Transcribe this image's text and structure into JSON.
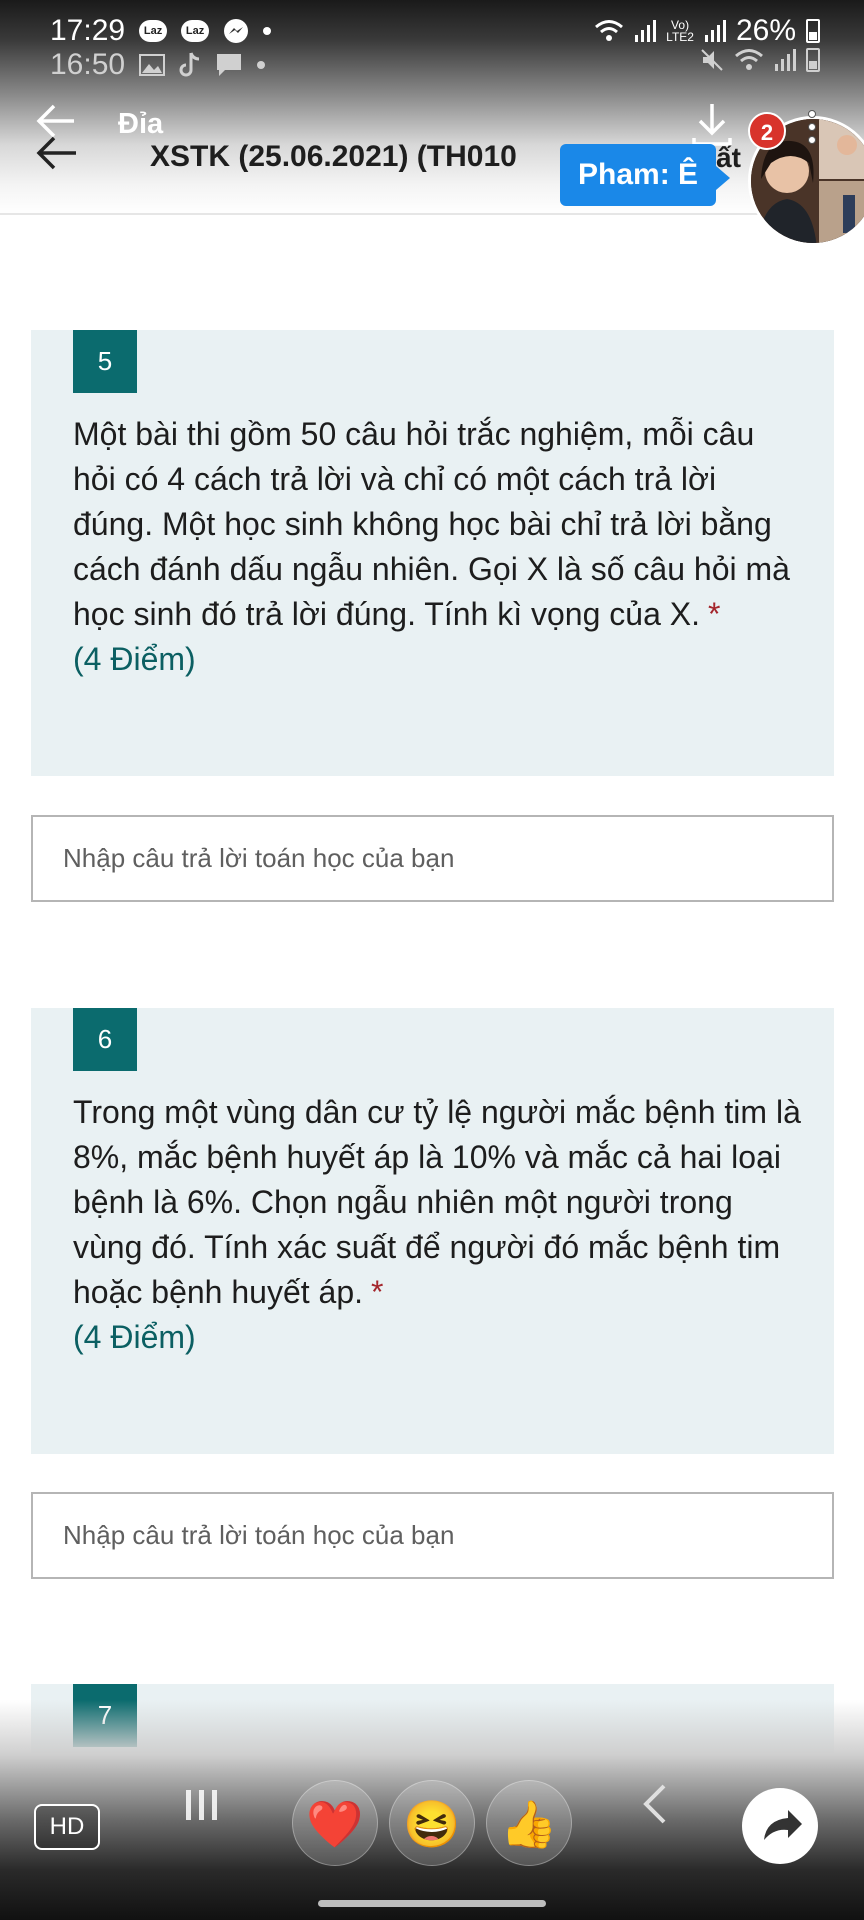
{
  "status_bar": {
    "time_primary": "17:29",
    "time_secondary": "16:50",
    "battery_percent": "26%",
    "notification_icons_primary": [
      "lazada-icon",
      "lazada-icon",
      "messenger-icon"
    ],
    "notification_icons_secondary": [
      "gallery-icon",
      "tiktok-icon",
      "chat-icon"
    ]
  },
  "chat_header": {
    "title": "Đỉa",
    "badge_count": "2",
    "tooltip": "Pham: Ê"
  },
  "form_header": {
    "title": "XSTK (25.06.2021) (TH010",
    "title_tail": "ất"
  },
  "questions": [
    {
      "number": "5",
      "text": "Một bài thi gồm 50 câu hỏi trắc nghiệm, mỗi câu hỏi có 4 cách trả lời và chỉ có một cách trả lời đúng. Một học sinh không học bài chỉ trả lời bằng cách đánh dấu ngẫu nhiên. Gọi X là số câu hỏi mà học  sinh đó trả lời đúng. Tính kì vọng của X.",
      "required_mark": "*",
      "points": "(4 Điểm)",
      "answer_placeholder": "Nhập câu trả lời toán học của bạn",
      "answer_value": ""
    },
    {
      "number": "6",
      "text": "Trong một vùng dân cư tỷ lệ người mắc bệnh tim là 8%, mắc bệnh huyết áp là 10% và mắc cả hai loại bệnh là 6%. Chọn ngẫu nhiên một người trong vùng đó. Tính xác suất để người đó mắc bệnh tim hoặc bệnh huyết áp.",
      "required_mark": "*",
      "points": "(4 Điểm)",
      "answer_placeholder": "Nhập câu trả lời toán học của bạn",
      "answer_value": ""
    },
    {
      "number": "7"
    }
  ],
  "bottom_bar": {
    "hd_label": "HD",
    "reactions": [
      "❤️",
      "😆",
      "👍"
    ]
  },
  "colors": {
    "accent_teal": "#0b6b6e",
    "card_bg": "#e9f1f3",
    "required_red": "#a4262c",
    "tooltip_blue": "#1a88e8",
    "badge_red": "#d8332b"
  }
}
